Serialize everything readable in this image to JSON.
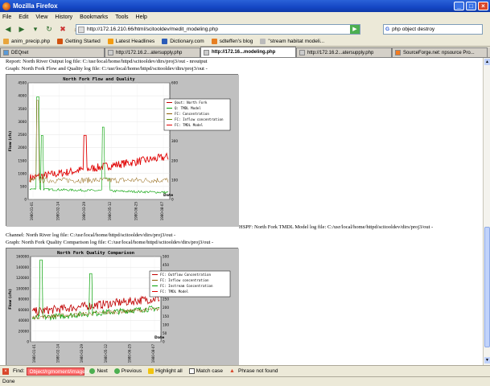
{
  "window": {
    "title": "Mozilla Firefox"
  },
  "menu": [
    "File",
    "Edit",
    "View",
    "History",
    "Bookmarks",
    "Tools",
    "Help"
  ],
  "nav": {
    "url": "http://172.16.210.66/html/scitooldev/medit_modeling.php",
    "search": "php object destroy"
  },
  "bookmarks": [
    "anim_precip.php",
    "Getting Started",
    "Latest Headlines",
    "Dictionary.com",
    "sdteffen's blog",
    "\"stream habitat modeli..."
  ],
  "tabs": [
    "DEQnet",
    "http://172.16.2...atersupply.php",
    "http://172.16...modeling.php",
    "http://172.16.2...atersupply.php",
    "SourceForge.net: npsource Pro..."
  ],
  "page": {
    "line1": "Report: North River Output log file: C:/usr/local/home/httpd/scitooldev/dirs/proj3/out - nroutput",
    "line2": "Graph: North Fork Flow and Quality log file: C:/usr/local/home/httpd/scitooldev/dirs/proj3/out -",
    "hspf": "HSPF: North Fork TMDL Model log file: C:/usr/local/home/httpd/scitooldev/dirs/proj3/out -",
    "line3": "Channel: North River log file: C:/usr/local/home/httpd/scitooldev/dirs/proj3/out -",
    "line4": "Graph: North Fork Quality Comparison log file: C:/usr/local/home/httpd/scitooldev/dirs/proj3/out -"
  },
  "chart_data": [
    {
      "type": "line",
      "title": "North Fork Flow and Quality",
      "ylabel": "Flow (cfs)",
      "xlabel": "Date",
      "yticks": [
        "0",
        "500",
        "1000",
        "1500",
        "2000",
        "2500",
        "3000",
        "3500",
        "4000",
        "4500"
      ],
      "y2ticks": [
        "0",
        "100",
        "200",
        "300",
        "400",
        "500",
        "600"
      ],
      "xticks": [
        "1980-01-01",
        "1980-02-14",
        "1980-03-29",
        "1980-05-12",
        "1980-06-25",
        "1980-08-07"
      ],
      "ylim": [
        0,
        4500
      ],
      "legend": [
        "Qout: North Fork",
        "Q: TMDL Model",
        "FC: Concentration",
        "FC: Inflow concentration",
        "FC: TMDL Model"
      ],
      "colors": [
        "#c00000",
        "#00a000",
        "#8b5a00",
        "#5a8a00",
        "#e00000"
      ]
    },
    {
      "type": "line",
      "title": "North Fork Quality Comparison",
      "ylabel": "Flow (cfs)",
      "xlabel": "Date",
      "yticks": [
        "0",
        "20000",
        "40000",
        "60000",
        "80000",
        "100000",
        "120000",
        "140000",
        "160000"
      ],
      "y2ticks": [
        "0",
        "50",
        "100",
        "150",
        "200",
        "250",
        "300",
        "350",
        "400",
        "450",
        "500"
      ],
      "xticks": [
        "1980-01-01",
        "1980-02-14",
        "1980-03-29",
        "1980-05-12",
        "1980-06-25",
        "1980-08-07"
      ],
      "ylim": [
        0,
        160000
      ],
      "legend": [
        "FC: Outflow Concentration",
        "FC: Inflow concentration",
        "FC: Instream Concentration",
        "FC: TMDL Model"
      ],
      "colors": [
        "#c00000",
        "#8b5a00",
        "#00a000",
        "#e00000"
      ]
    }
  ],
  "findbar": {
    "label": "Find:",
    "value": "Object/rgmoment/images/",
    "next": "Next",
    "previous": "Previous",
    "highlight": "Highlight all",
    "match": "Match case",
    "notfound": "Phrase not found"
  },
  "status": "Done"
}
